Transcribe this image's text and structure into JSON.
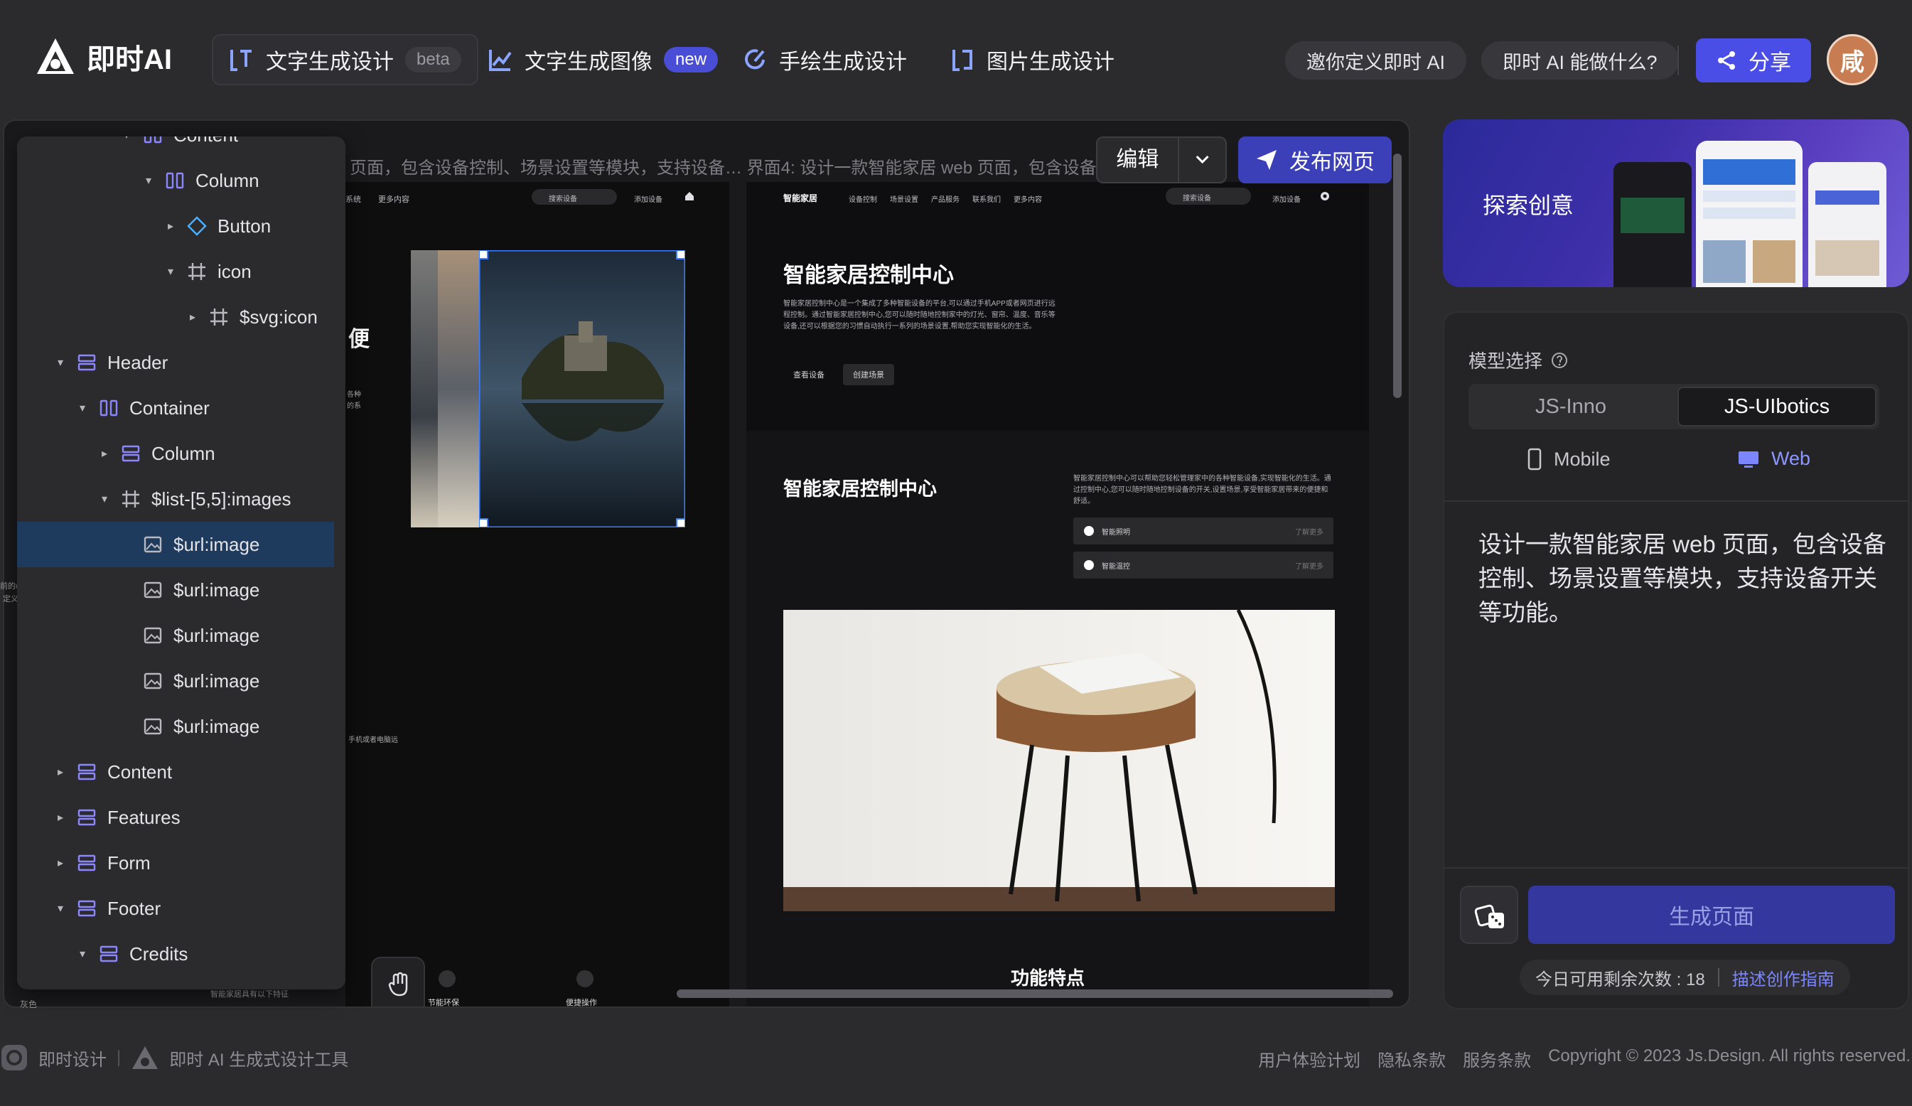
{
  "app": {
    "name": "即时AI"
  },
  "nav": {
    "tabs": [
      {
        "label": "文字生成设计",
        "badge": "beta",
        "active": true
      },
      {
        "label": "文字生成图像",
        "badge": "new",
        "active": false
      },
      {
        "label": "手绘生成设计",
        "badge": "",
        "active": false
      },
      {
        "label": "图片生成设计",
        "badge": "",
        "active": false
      }
    ],
    "invite": "邀你定义即时 AI",
    "what": "即时 AI 能做什么?",
    "share": "分享",
    "avatar": "咸"
  },
  "canvas": {
    "caption": "页面，包含设备控制、场景设置等模块，支持设备… 界面4: 设计一款智能家居 web 页面，包含设备",
    "edit": "编辑",
    "publish": "发布网页",
    "frameA_heading_fragment": "便",
    "frameA_small_1": "各种",
    "frameA_small_2": "的系",
    "frameA_small_3": "手机或者电脑远",
    "frameA_bottom_1": "节能环保",
    "frameA_bottom_2": "便捷操作",
    "frameB": {
      "logo": "智能家居",
      "nav": [
        "设备控制",
        "场景设置",
        "产品服务",
        "联系我们",
        "更多内容"
      ],
      "search": "搜索设备",
      "add": "添加设备",
      "hero_title": "智能家居控制中心",
      "hero_text": "智能家居控制中心是一个集成了多种智能设备的平台,可以通过手机APP或者网页进行远程控制。通过智能家居控制中心,您可以随时随地控制家中的灯光、窗帘、温度、音乐等设备,还可以根据您的习惯自动执行一系列的场景设置,帮助您实现智能化的生活。",
      "btn1": "查看设备",
      "btn2": "创建场景",
      "sec_title": "智能家居控制中心",
      "sec_text": "智能家居控制中心可以帮助您轻松管理家中的各种智能设备,实现智能化的生活。通过控制中心,您可以随时随地控制设备的开关,设置场景,享受智能家居带来的便捷和舒适。",
      "row1": "智能照明",
      "row2": "智能温控",
      "row_tag": "了解更多",
      "features": "功能特点"
    },
    "frameA_nav": [
      "系统",
      "更多内容"
    ],
    "frameA_search": "搜索设备",
    "frameA_add": "添加设备"
  },
  "layers": [
    {
      "label": "Content",
      "depth": 4,
      "type": "column",
      "caret": "down"
    },
    {
      "label": "Column",
      "depth": 5,
      "type": "column",
      "caret": "down"
    },
    {
      "label": "Button",
      "depth": 6,
      "type": "component",
      "caret": "right"
    },
    {
      "label": "icon",
      "depth": 6,
      "type": "frame",
      "caret": "down"
    },
    {
      "label": "$svg:icon",
      "depth": 7,
      "type": "frame",
      "caret": "right"
    },
    {
      "label": "Header",
      "depth": 1,
      "type": "rows",
      "caret": "down"
    },
    {
      "label": "Container",
      "depth": 2,
      "type": "column",
      "caret": "down"
    },
    {
      "label": "Column",
      "depth": 3,
      "type": "rows",
      "caret": "right"
    },
    {
      "label": "$list-[5,5]:images",
      "depth": 3,
      "type": "frame",
      "caret": "down"
    },
    {
      "label": "$url:image",
      "depth": 4,
      "type": "image",
      "caret": "",
      "selected": true
    },
    {
      "label": "$url:image",
      "depth": 4,
      "type": "image",
      "caret": ""
    },
    {
      "label": "$url:image",
      "depth": 4,
      "type": "image",
      "caret": ""
    },
    {
      "label": "$url:image",
      "depth": 4,
      "type": "image",
      "caret": ""
    },
    {
      "label": "$url:image",
      "depth": 4,
      "type": "image",
      "caret": ""
    },
    {
      "label": "Content",
      "depth": 1,
      "type": "rows",
      "caret": "right"
    },
    {
      "label": "Features",
      "depth": 1,
      "type": "rows",
      "caret": "right"
    },
    {
      "label": "Form",
      "depth": 1,
      "type": "rows",
      "caret": "right"
    },
    {
      "label": "Footer",
      "depth": 1,
      "type": "rows",
      "caret": "down"
    },
    {
      "label": "Credits",
      "depth": 2,
      "type": "rows",
      "caret": "down"
    }
  ],
  "left_edge": {
    "t1": "前的#",
    "t2": "定义",
    "t3": "灰色"
  },
  "frameA_bottom_text": "智能家居具有以下特征",
  "right": {
    "banner": "探索创意",
    "model_title": "模型选择",
    "models": [
      "JS-Inno",
      "JS-UIbotics"
    ],
    "model_selected": "JS-UIbotics",
    "device_mobile": "Mobile",
    "device_web": "Web",
    "prompt": "设计一款智能家居 web 页面，包含设备控制、场景设置等模块，支持设备开关等功能。",
    "generate": "生成页面",
    "quota_label": "今日可用剩余次数 : 18",
    "guide": "描述创作指南"
  },
  "footer": {
    "brand1": "即时设计",
    "brand2": "即时 AI 生成式设计工具",
    "links": [
      "用户体验计划",
      "隐私条款",
      "服务条款",
      "Copyright © 2023 Js.Design. All rights reserved."
    ]
  },
  "colors": {
    "accent": "#4a4ee6",
    "selection": "#1e3a5c",
    "background": "#2b2b2d"
  }
}
